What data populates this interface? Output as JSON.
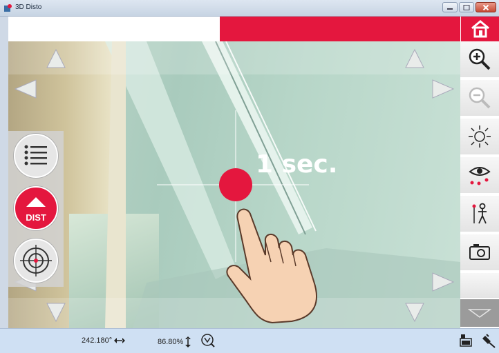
{
  "window": {
    "title": "3D Disto"
  },
  "viewport": {
    "hint_text": "1 sec."
  },
  "left_panel": {
    "dist_label": "DIST"
  },
  "status_bar": {
    "horizontal_angle": "242.180°",
    "vertical_angle": "86.80%"
  },
  "colors": {
    "accent": "#e4173e",
    "toolbar_bg": "#e8e8e8",
    "statusbar_bg": "#cfe0f3"
  },
  "icons": {
    "home": "home-icon",
    "zoom_in": "zoom-in-icon",
    "zoom_out": "zoom-out-icon",
    "brightness": "brightness-icon",
    "view": "eye-points-icon",
    "person": "person-height-icon",
    "camera": "camera-icon",
    "more": "chevron-down-icon"
  }
}
